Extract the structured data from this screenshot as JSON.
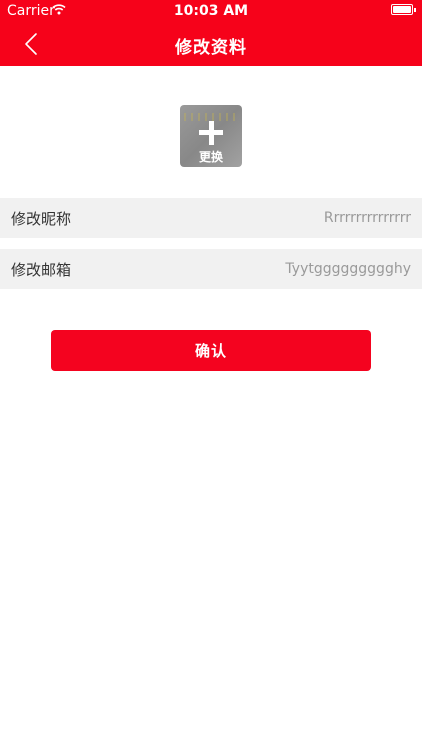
{
  "status_bar": {
    "carrier": "Carrier",
    "time": "10:03 AM",
    "icons": [
      "wifi-icon",
      "battery-icon"
    ]
  },
  "nav": {
    "title": "修改资料",
    "back_icon": "chevron-left-icon"
  },
  "avatar": {
    "icon": "plus-icon",
    "change_label": "更换"
  },
  "form": {
    "nickname": {
      "label": "修改昵称",
      "value": "Rrrrrrrrrrrrrrr"
    },
    "email": {
      "label": "修改邮箱",
      "value": "Tyytggggggggghy"
    }
  },
  "confirm_label": "确认",
  "colors": {
    "brand_red": "#f6021a",
    "button_red": "#f4031f",
    "row_background": "#f1f1f1",
    "value_text": "#9a9a9a"
  }
}
